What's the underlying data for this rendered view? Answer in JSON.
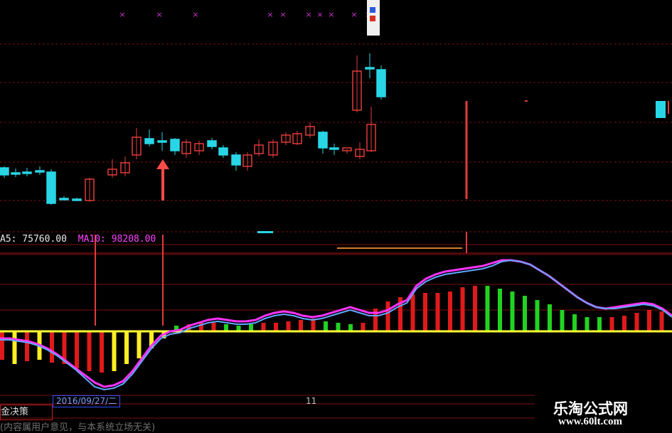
{
  "colors": {
    "up": "#e23b3b",
    "down": "#29d6e6",
    "grid": "#7a0f0f",
    "zero_line": "#ffff33",
    "macd_up": "#e01a1a",
    "macd_up_weak": "#21d321",
    "macd_neg": "#e01a1a",
    "macd_neg_weak": "#ffee22",
    "signal_line": "#ff33ff",
    "dif_line": "#5fa8ff",
    "arrow": "#ff4a4a",
    "marker": "#cc33cc"
  },
  "ma_readout": {
    "ma5": "A5: 75760.00",
    "ma10": "MA10: 98208.00"
  },
  "date_label": "2016/09/27/二",
  "axis_tick": "11",
  "formula_tab": "金决策",
  "disclaimer": "(内容属用户意见，与本系统立场无关)",
  "watermark": {
    "title": "乐淘公式网",
    "url": "www.60lt.com"
  },
  "chart_data": {
    "type": "candlestick+histogram",
    "candles": [
      {
        "o": 236,
        "c": 246,
        "h": 234,
        "l": 250
      },
      {
        "o": 243,
        "c": 243,
        "h": 237,
        "l": 249
      },
      {
        "o": 242,
        "c": 242,
        "h": 236,
        "l": 248
      },
      {
        "o": 240,
        "c": 240,
        "h": 234,
        "l": 246
      },
      {
        "o": 242,
        "c": 286,
        "h": 238,
        "l": 288
      },
      {
        "o": 279,
        "c": 279,
        "h": 276,
        "l": 282
      },
      {
        "o": 280,
        "c": 280,
        "h": 278,
        "l": 282
      },
      {
        "o": 282,
        "c": 252,
        "h": 250,
        "l": 284
      },
      {
        "o": 246,
        "c": 238,
        "h": 224,
        "l": 250
      },
      {
        "o": 243,
        "c": 229,
        "h": 220,
        "l": 248
      },
      {
        "o": 218,
        "c": 193,
        "h": 180,
        "l": 224
      },
      {
        "o": 195,
        "c": 202,
        "h": 182,
        "l": 206
      },
      {
        "o": 198,
        "c": 198,
        "h": 186,
        "l": 212
      },
      {
        "o": 196,
        "c": 212,
        "h": 194,
        "l": 218
      },
      {
        "o": 216,
        "c": 200,
        "h": 196,
        "l": 222
      },
      {
        "o": 212,
        "c": 202,
        "h": 198,
        "l": 218
      },
      {
        "o": 198,
        "c": 206,
        "h": 194,
        "l": 210
      },
      {
        "o": 208,
        "c": 218,
        "h": 204,
        "l": 222
      },
      {
        "o": 218,
        "c": 232,
        "h": 214,
        "l": 240
      },
      {
        "o": 234,
        "c": 218,
        "h": 214,
        "l": 240
      },
      {
        "o": 216,
        "c": 204,
        "h": 196,
        "l": 220
      },
      {
        "o": 218,
        "c": 200,
        "h": 196,
        "l": 222
      },
      {
        "o": 200,
        "c": 190,
        "h": 186,
        "l": 204
      },
      {
        "o": 202,
        "c": 188,
        "h": 184,
        "l": 204
      },
      {
        "o": 190,
        "c": 178,
        "h": 172,
        "l": 194
      },
      {
        "o": 186,
        "c": 208,
        "h": 184,
        "l": 216
      },
      {
        "o": 208,
        "c": 208,
        "h": 202,
        "l": 218
      },
      {
        "o": 212,
        "c": 208,
        "h": 210,
        "l": 216
      },
      {
        "o": 220,
        "c": 210,
        "h": 200,
        "l": 224
      },
      {
        "o": 212,
        "c": 175,
        "h": 150,
        "l": 214
      },
      {
        "o": 155,
        "c": 100,
        "h": 78,
        "l": 158
      },
      {
        "o": 95,
        "c": 95,
        "h": 75,
        "l": 110
      },
      {
        "o": 98,
        "c": 136,
        "h": 92,
        "l": 140
      }
    ],
    "histogram": [
      {
        "v": -40,
        "c": "macd_neg"
      },
      {
        "v": -46,
        "c": "macd_neg_weak"
      },
      {
        "v": -42,
        "c": "macd_neg"
      },
      {
        "v": -40,
        "c": "macd_neg_weak"
      },
      {
        "v": -44,
        "c": "macd_neg"
      },
      {
        "v": -46,
        "c": "macd_neg"
      },
      {
        "v": -52,
        "c": "macd_neg"
      },
      {
        "v": -56,
        "c": "macd_neg"
      },
      {
        "v": -58,
        "c": "macd_neg"
      },
      {
        "v": -56,
        "c": "macd_neg_weak"
      },
      {
        "v": -46,
        "c": "macd_neg_weak"
      },
      {
        "v": -38,
        "c": "macd_neg_weak"
      },
      {
        "v": -24,
        "c": "macd_neg_weak"
      },
      {
        "v": -10,
        "c": "macd_neg_weak"
      },
      {
        "v": 8,
        "c": "macd_up_weak"
      },
      {
        "v": 10,
        "c": "macd_up"
      },
      {
        "v": 12,
        "c": "macd_up"
      },
      {
        "v": 12,
        "c": "macd_up"
      },
      {
        "v": 10,
        "c": "macd_up_weak"
      },
      {
        "v": 8,
        "c": "macd_up_weak"
      },
      {
        "v": 10,
        "c": "macd_up_weak"
      },
      {
        "v": 12,
        "c": "macd_up"
      },
      {
        "v": 12,
        "c": "macd_up"
      },
      {
        "v": 14,
        "c": "macd_up"
      },
      {
        "v": 16,
        "c": "macd_up"
      },
      {
        "v": 18,
        "c": "macd_up"
      },
      {
        "v": 14,
        "c": "macd_up_weak"
      },
      {
        "v": 12,
        "c": "macd_up_weak"
      },
      {
        "v": 10,
        "c": "macd_up_weak"
      },
      {
        "v": 12,
        "c": "macd_up"
      },
      {
        "v": 32,
        "c": "macd_up"
      },
      {
        "v": 42,
        "c": "macd_up"
      },
      {
        "v": 48,
        "c": "macd_up"
      },
      {
        "v": 52,
        "c": "macd_up"
      },
      {
        "v": 54,
        "c": "macd_up"
      },
      {
        "v": 54,
        "c": "macd_up"
      },
      {
        "v": 56,
        "c": "macd_up"
      },
      {
        "v": 62,
        "c": "macd_up"
      },
      {
        "v": 64,
        "c": "macd_up"
      },
      {
        "v": 64,
        "c": "macd_up_weak"
      },
      {
        "v": 60,
        "c": "macd_up_weak"
      },
      {
        "v": 56,
        "c": "macd_up_weak"
      },
      {
        "v": 50,
        "c": "macd_up_weak"
      },
      {
        "v": 44,
        "c": "macd_up_weak"
      },
      {
        "v": 38,
        "c": "macd_up_weak"
      },
      {
        "v": 30,
        "c": "macd_up_weak"
      },
      {
        "v": 24,
        "c": "macd_up_weak"
      },
      {
        "v": 20,
        "c": "macd_up_weak"
      },
      {
        "v": 20,
        "c": "macd_up_weak"
      },
      {
        "v": 20,
        "c": "macd_up"
      },
      {
        "v": 22,
        "c": "macd_up"
      },
      {
        "v": 26,
        "c": "macd_up"
      },
      {
        "v": 30,
        "c": "macd_up"
      },
      {
        "v": 28,
        "c": "macd_up"
      },
      {
        "v": 18,
        "c": "macd_up_weak"
      }
    ],
    "dif": [
      -12,
      -12,
      -14,
      -16,
      -20,
      -26,
      -34,
      -44,
      -54,
      -66,
      -78,
      -82,
      -80,
      -74,
      -60,
      -42,
      -24,
      -10,
      -4,
      -2,
      4,
      8,
      12,
      14,
      12,
      10,
      10,
      12,
      18,
      22,
      24,
      22,
      18,
      16,
      18,
      22,
      26,
      30,
      26,
      22,
      22,
      26,
      34,
      40,
      60,
      70,
      76,
      80,
      82,
      84,
      86,
      88,
      92,
      98,
      100,
      98,
      94,
      86,
      78,
      68,
      58,
      48,
      40,
      34,
      32,
      32,
      34,
      36,
      38,
      36,
      30,
      20
    ],
    "dea": [
      -10,
      -10,
      -12,
      -14,
      -18,
      -24,
      -32,
      -42,
      -52,
      -62,
      -72,
      -78,
      -76,
      -70,
      -56,
      -38,
      -20,
      -6,
      0,
      2,
      8,
      12,
      16,
      18,
      16,
      14,
      14,
      16,
      22,
      26,
      28,
      26,
      22,
      20,
      22,
      26,
      30,
      34,
      30,
      26,
      26,
      30,
      38,
      44,
      64,
      74,
      80,
      84,
      86,
      88,
      90,
      92,
      96,
      100,
      100,
      98,
      94,
      86,
      78,
      68,
      58,
      48,
      40,
      34,
      32,
      34,
      36,
      38,
      40,
      38,
      32,
      22
    ]
  },
  "markers": [
    "x",
    "x",
    "x",
    "x",
    "x",
    "x",
    "x",
    "x",
    "x",
    "x"
  ]
}
